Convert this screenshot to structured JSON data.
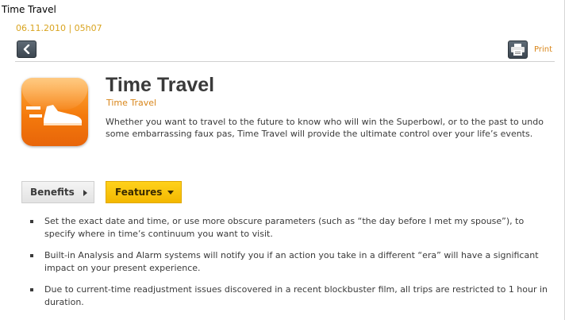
{
  "window": {
    "title": "Time Travel"
  },
  "meta": {
    "date_time": "06.11.2010 | 05h07"
  },
  "toolbar": {
    "back_icon": "chevron-left-icon",
    "print_icon": "printer-icon",
    "print_label": "Print"
  },
  "app": {
    "icon": "running-shoe-icon",
    "title": "Time Travel",
    "subtitle": "Time Travel",
    "description": "Whether you want to travel to the future to know who will win the Superbowl, or to the past to undo some embarrassing faux pas, Time Travel will provide the ultimate control over your life’s events."
  },
  "tabs": [
    {
      "label": "Benefits",
      "active": false,
      "icon": "arrow-right-icon"
    },
    {
      "label": "Features",
      "active": true,
      "icon": "arrow-down-icon"
    }
  ],
  "features": [
    "Set the exact date and time, or use more obscure parameters (such as “the day before I met my spouse”), to specify where in time’s continuum you want to visit.",
    "Built-in Analysis and Alarm systems will notify you if an action you take in a different “era” will have a significant impact on your present experience.",
    "Due to current-time readjustment issues discovered in a recent blockbuster film, all trips are restricted to 1 hour in duration."
  ],
  "colors": {
    "accent_orange": "#d9861a",
    "date_gold": "#d9a420",
    "tab_active": "#ffd21c",
    "icon_orange": "#f47a0c"
  }
}
